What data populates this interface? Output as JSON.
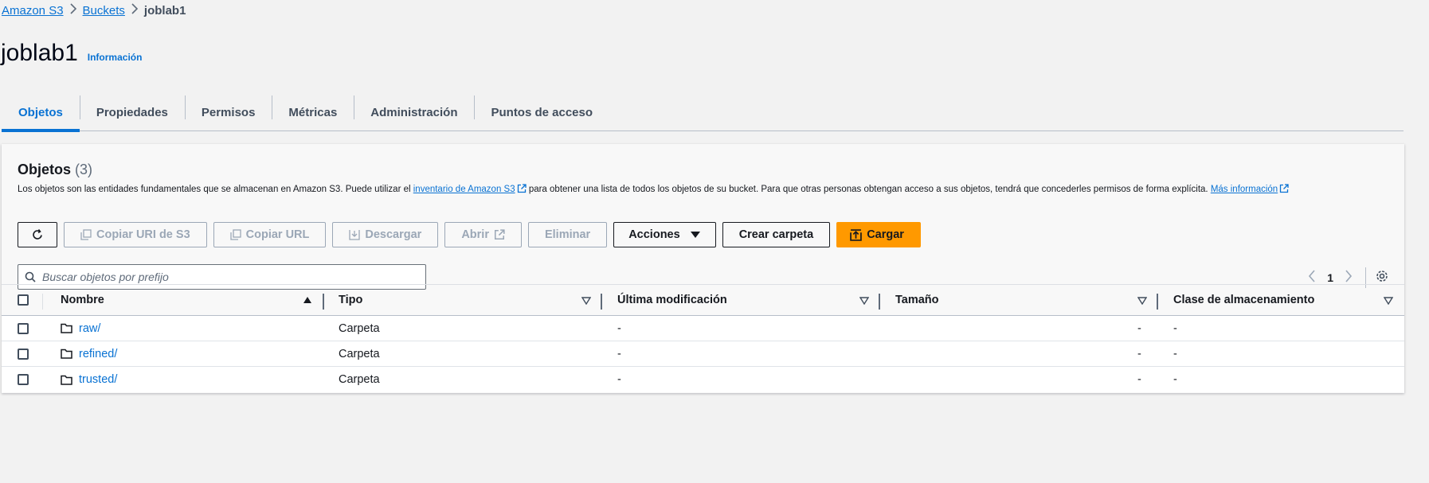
{
  "breadcrumb": {
    "items": [
      "Amazon S3",
      "Buckets"
    ],
    "current": "joblab1"
  },
  "header": {
    "title": "joblab1",
    "info": "Información"
  },
  "tabs": [
    {
      "label": "Objetos",
      "active": true
    },
    {
      "label": "Propiedades"
    },
    {
      "label": "Permisos"
    },
    {
      "label": "Métricas"
    },
    {
      "label": "Administración"
    },
    {
      "label": "Puntos de acceso"
    }
  ],
  "objects": {
    "title": "Objetos",
    "count": "(3)",
    "description_1": "Los objetos son las entidades fundamentales que se almacenan en Amazon S3. Puede utilizar el",
    "description_link_1": "inventario de Amazon S3",
    "description_2": "para obtener una lista de todos los objetos de su bucket. Para que otras personas obtengan acceso a sus objetos, tendrá que concederles permisos de forma explícita.",
    "description_link_2": "Más información",
    "buttons": {
      "copy_uri": "Copiar URI de S3",
      "copy_url": "Copiar URL",
      "download": "Descargar",
      "open": "Abrir",
      "delete": "Eliminar",
      "actions": "Acciones",
      "create_folder": "Crear carpeta",
      "upload": "Cargar"
    },
    "search_placeholder": "Buscar objetos por prefijo",
    "page": "1",
    "columns": [
      "Nombre",
      "Tipo",
      "Última modificación",
      "Tamaño",
      "Clase de almacenamiento"
    ],
    "rows": [
      {
        "name": "raw/",
        "type": "Carpeta",
        "modified": "-",
        "size": "-",
        "class": "-"
      },
      {
        "name": "refined/",
        "type": "Carpeta",
        "modified": "-",
        "size": "-",
        "class": "-"
      },
      {
        "name": "trusted/",
        "type": "Carpeta",
        "modified": "-",
        "size": "-",
        "class": "-"
      }
    ]
  },
  "colors": {
    "link": "#0972d3",
    "primary_button": "#ff9900"
  }
}
